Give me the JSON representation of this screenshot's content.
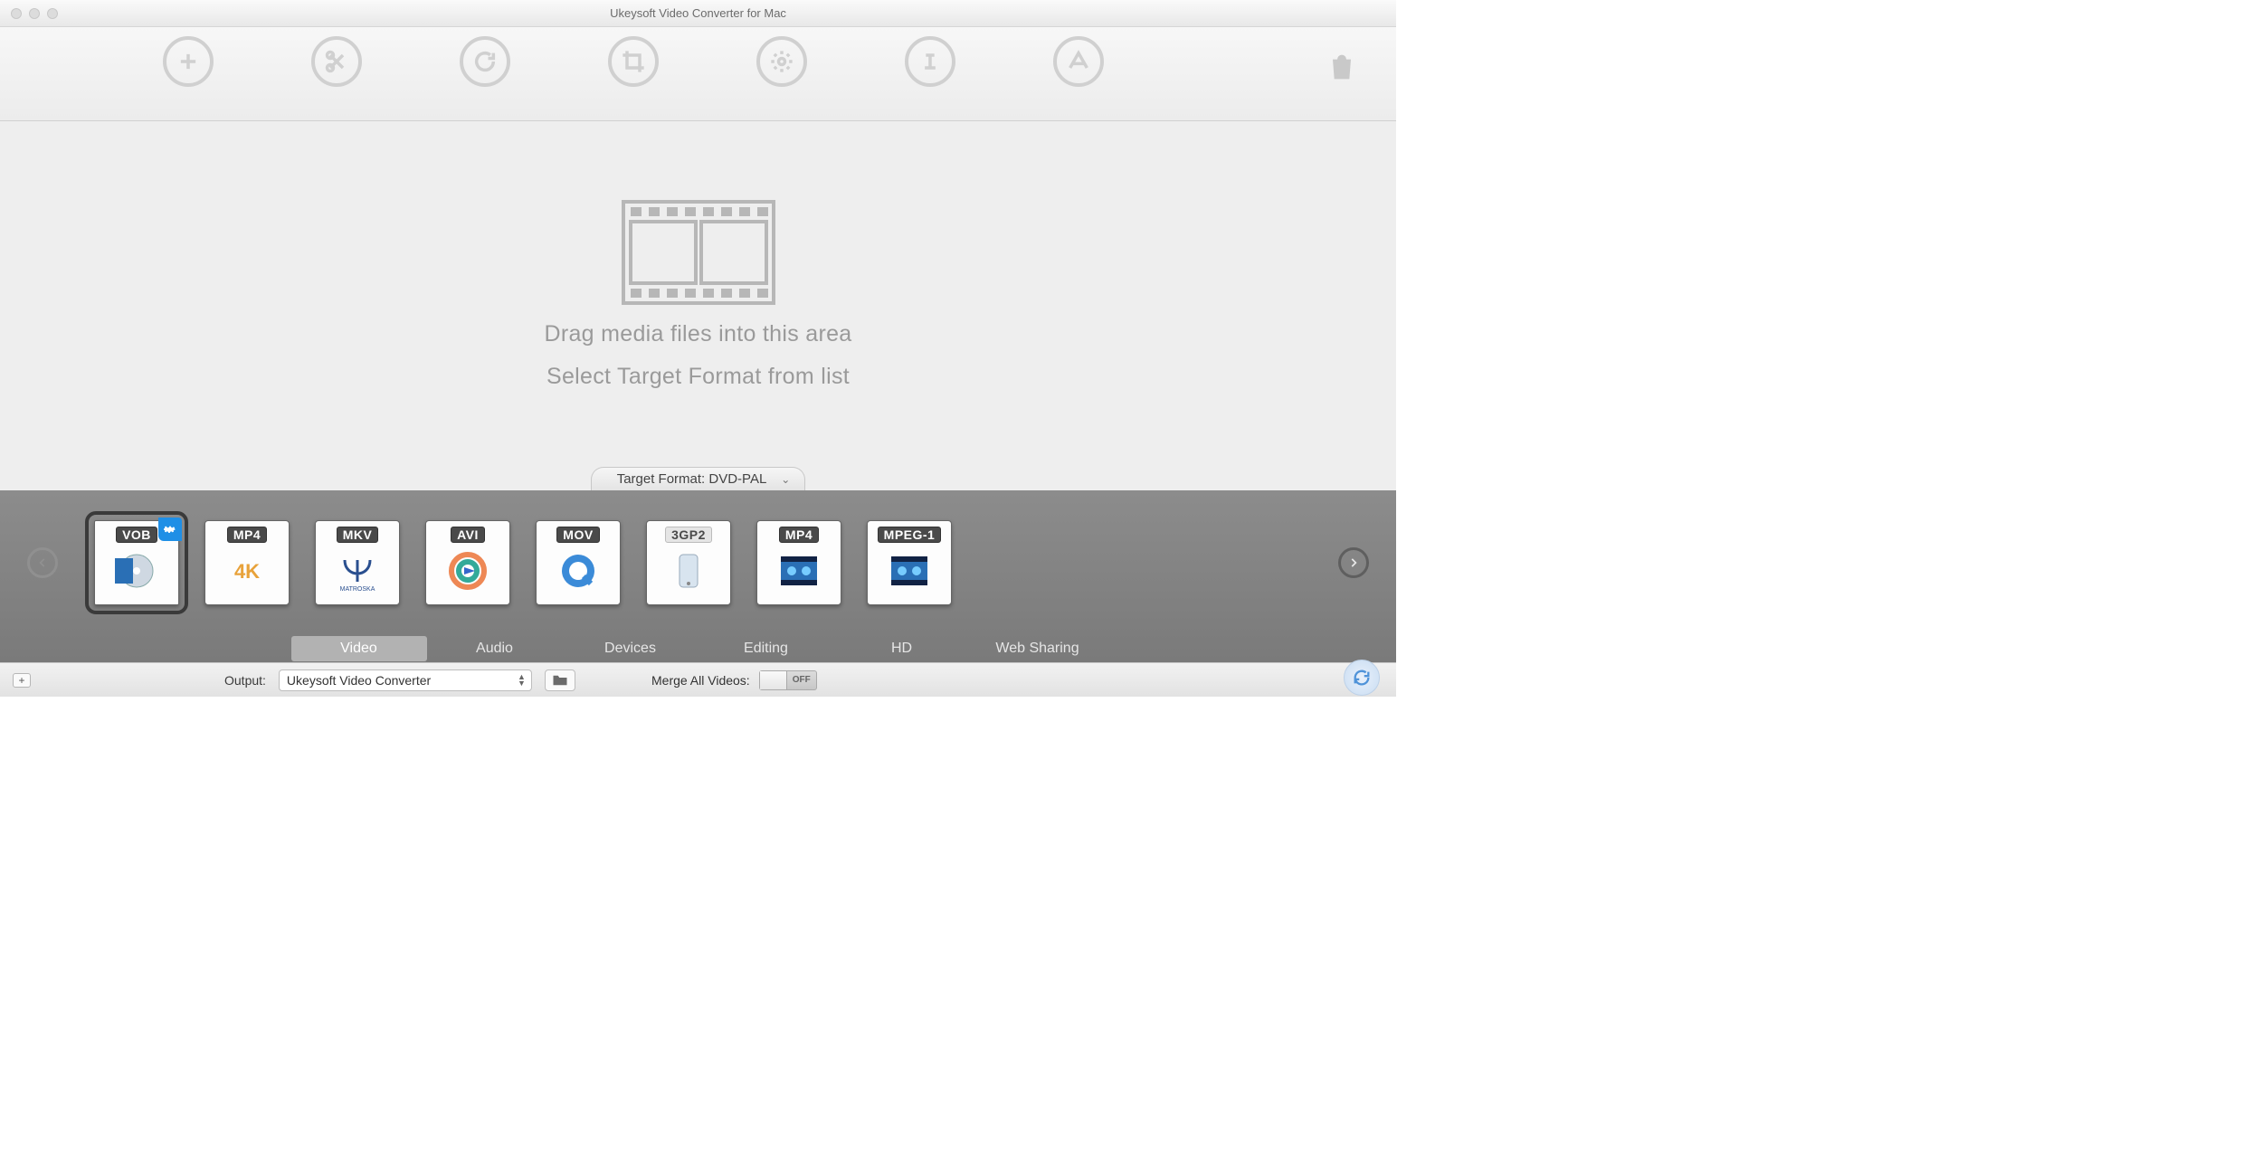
{
  "titlebar": {
    "title": "Ukeysoft Video Converter for Mac"
  },
  "toolbar": {
    "icons": [
      "add",
      "cut",
      "rotate",
      "crop",
      "effects",
      "text",
      "watermark"
    ],
    "store_icon": "shopping-bag"
  },
  "drop": {
    "line1": "Drag media files into this area",
    "line2": "Select Target Format from list"
  },
  "target_format": {
    "label_prefix": "Target Format: ",
    "value": "DVD-PAL"
  },
  "formats": [
    {
      "code": "VOB",
      "selected": true,
      "dark": true,
      "art": "disc"
    },
    {
      "code": "MP4",
      "selected": false,
      "dark": true,
      "art": "4k"
    },
    {
      "code": "MKV",
      "selected": false,
      "dark": true,
      "art": "matroska"
    },
    {
      "code": "AVI",
      "selected": false,
      "dark": true,
      "art": "swirl"
    },
    {
      "code": "MOV",
      "selected": false,
      "dark": true,
      "art": "qt"
    },
    {
      "code": "3GP2",
      "selected": false,
      "dark": false,
      "art": "phone"
    },
    {
      "code": "MP4",
      "selected": false,
      "dark": true,
      "art": "film"
    },
    {
      "code": "MPEG-1",
      "selected": false,
      "dark": true,
      "art": "film"
    }
  ],
  "tabs": [
    "Video",
    "Audio",
    "Devices",
    "Editing",
    "HD",
    "Web Sharing"
  ],
  "active_tab": 0,
  "footer": {
    "output_label": "Output:",
    "output_value": "Ukeysoft Video Converter",
    "merge_label": "Merge All Videos:",
    "merge_state": "OFF"
  }
}
